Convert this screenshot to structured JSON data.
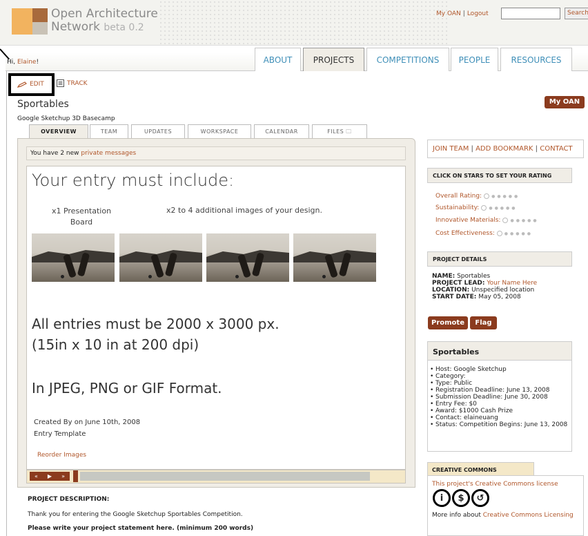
{
  "header": {
    "logo_line1": "Open Architecture",
    "logo_line2": "Network",
    "logo_beta": "beta 0.2",
    "link_myoan": "My OAN",
    "link_logout": "Logout",
    "search_button": "Search"
  },
  "nav": {
    "greeting_prefix": "Hi, ",
    "user_name": "Elaine",
    "greeting_suffix": "!",
    "tabs": [
      "ABOUT",
      "PROJECTS",
      "COMPETITIONS",
      "PEOPLE",
      "RESOURCES"
    ],
    "active_tab": "PROJECTS"
  },
  "actions": {
    "edit": "EDIT",
    "track": "TRACK"
  },
  "project": {
    "title": "Sportables",
    "subtitle": "Google Sketchup 3D Basecamp",
    "my_oan_button": "My OAN"
  },
  "subtabs": [
    "OVERVIEW",
    "TEAM",
    "UPDATES",
    "WORKSPACE",
    "CALENDAR",
    "FILES"
  ],
  "messages": {
    "prefix": "You have 2 new ",
    "link": "private messages"
  },
  "slide": {
    "heading": "Your entry must include:",
    "caption_left": "x1 Presentation Board",
    "caption_right": "x2 to 4 additional images of your design.",
    "size_line1": "All entries must be 2000 x 3000 px.",
    "size_line2": "(15in x 10 in at 200 dpi)",
    "format": "In JPEG, PNG or GIF Format.",
    "created_by": "Created By on June 10th, 2008",
    "template_name": "Entry Template",
    "reorder": "Reorder Images"
  },
  "player": {
    "prev": "«",
    "play": "▶",
    "next": "»"
  },
  "description": {
    "heading": "PROJECT DESCRIPTION:",
    "line1": "Thank you for entering the Google Sketchup Sportables Competition.",
    "line2": "Please write your project statement here. (minimum 200 words)"
  },
  "sidebar": {
    "join": "JOIN TEAM",
    "bookmark": "ADD BOOKMARK",
    "contact": "CONTACT",
    "rating_head": "CLICK ON STARS TO SET YOUR RATING",
    "ratings": [
      "Overall Rating:",
      "Sustainability:",
      "Innovative Materials:",
      "Cost Effectiveness:"
    ],
    "details_head": "PROJECT DETAILS",
    "details": {
      "name_label": "NAME:",
      "name": "Sportables",
      "lead_label": "PROJECT LEAD:",
      "lead": "Your Name Here",
      "location_label": "LOCATION:",
      "location": "Unspecified location",
      "start_label": "START DATE:",
      "start": "May 05, 2008"
    },
    "promote": "Promote",
    "flag": "Flag",
    "competition": {
      "title": "Sportables",
      "items": [
        "Host: Google Sketchup",
        "Category:",
        "Type: Public",
        "Registration Deadline: June 13, 2008",
        "Submission Deadline: June 30, 2008",
        "Entry Fee: $0",
        "Award: $1000 Cash Prize",
        "Contact: elaineuang",
        "Status: Competition Begins: June 13, 2008"
      ]
    },
    "cc": {
      "tab": "CREATIVE COMMONS",
      "license_text": "This project's Creative Commons license",
      "more_prefix": "More info about ",
      "more_link": "Creative Commons Licensing"
    }
  }
}
